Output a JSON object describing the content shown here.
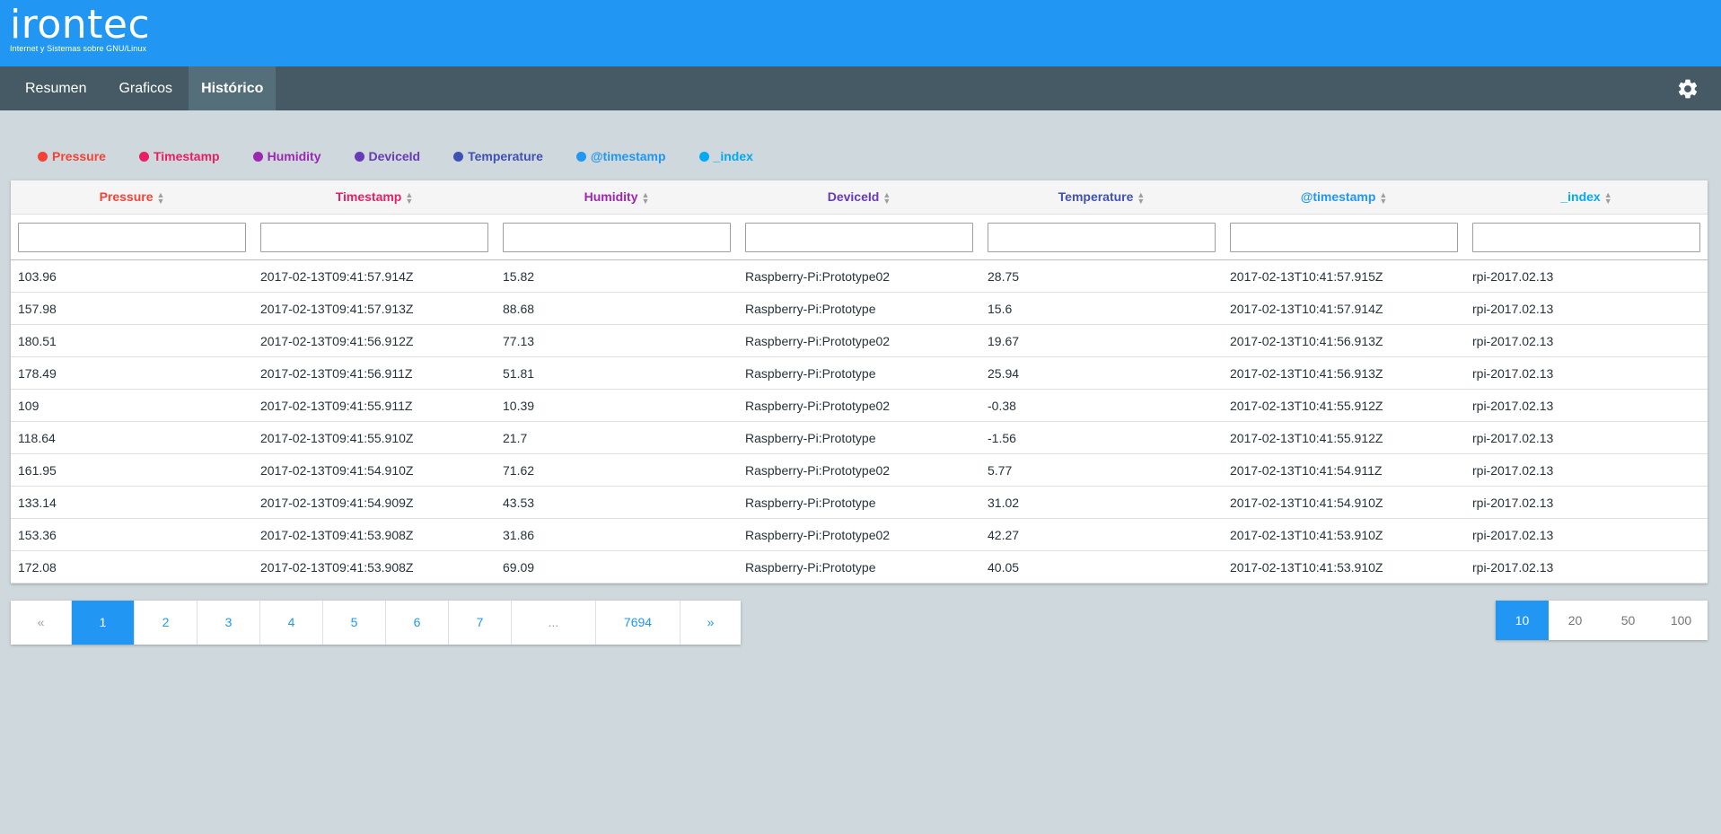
{
  "brand": {
    "name": "irontec",
    "tagline": "Internet y Sistemas sobre GNU/Linux"
  },
  "nav": {
    "items": [
      "Resumen",
      "Graficos",
      "Histórico"
    ],
    "active": "Histórico"
  },
  "colors": {
    "Pressure": "#f44336",
    "Timestamp": "#e91e63",
    "Humidity": "#9c27b0",
    "DeviceId": "#673ab7",
    "Temperature": "#3f51b5",
    "@timestamp": "#2196f3",
    "_index": "#03a9f4"
  },
  "columns": [
    "Pressure",
    "Timestamp",
    "Humidity",
    "DeviceId",
    "Temperature",
    "@timestamp",
    "_index"
  ],
  "rows": [
    [
      "103.96",
      "2017-02-13T09:41:57.914Z",
      "15.82",
      "Raspberry-Pi:Prototype02",
      "28.75",
      "2017-02-13T10:41:57.915Z",
      "rpi-2017.02.13"
    ],
    [
      "157.98",
      "2017-02-13T09:41:57.913Z",
      "88.68",
      "Raspberry-Pi:Prototype",
      "15.6",
      "2017-02-13T10:41:57.914Z",
      "rpi-2017.02.13"
    ],
    [
      "180.51",
      "2017-02-13T09:41:56.912Z",
      "77.13",
      "Raspberry-Pi:Prototype02",
      "19.67",
      "2017-02-13T10:41:56.913Z",
      "rpi-2017.02.13"
    ],
    [
      "178.49",
      "2017-02-13T09:41:56.911Z",
      "51.81",
      "Raspberry-Pi:Prototype",
      "25.94",
      "2017-02-13T10:41:56.913Z",
      "rpi-2017.02.13"
    ],
    [
      "109",
      "2017-02-13T09:41:55.911Z",
      "10.39",
      "Raspberry-Pi:Prototype02",
      "-0.38",
      "2017-02-13T10:41:55.912Z",
      "rpi-2017.02.13"
    ],
    [
      "118.64",
      "2017-02-13T09:41:55.910Z",
      "21.7",
      "Raspberry-Pi:Prototype",
      "-1.56",
      "2017-02-13T10:41:55.912Z",
      "rpi-2017.02.13"
    ],
    [
      "161.95",
      "2017-02-13T09:41:54.910Z",
      "71.62",
      "Raspberry-Pi:Prototype02",
      "5.77",
      "2017-02-13T10:41:54.911Z",
      "rpi-2017.02.13"
    ],
    [
      "133.14",
      "2017-02-13T09:41:54.909Z",
      "43.53",
      "Raspberry-Pi:Prototype",
      "31.02",
      "2017-02-13T10:41:54.910Z",
      "rpi-2017.02.13"
    ],
    [
      "153.36",
      "2017-02-13T09:41:53.908Z",
      "31.86",
      "Raspberry-Pi:Prototype02",
      "42.27",
      "2017-02-13T10:41:53.910Z",
      "rpi-2017.02.13"
    ],
    [
      "172.08",
      "2017-02-13T09:41:53.908Z",
      "69.09",
      "Raspberry-Pi:Prototype",
      "40.05",
      "2017-02-13T10:41:53.910Z",
      "rpi-2017.02.13"
    ]
  ],
  "pagination": {
    "prev": "«",
    "pages": [
      "1",
      "2",
      "3",
      "4",
      "5",
      "6",
      "7",
      "...",
      "7694"
    ],
    "next": "»",
    "current": "1"
  },
  "page_sizes": {
    "options": [
      "10",
      "20",
      "50",
      "100"
    ],
    "selected": "10"
  },
  "icons": {
    "settings": "gear-icon"
  }
}
